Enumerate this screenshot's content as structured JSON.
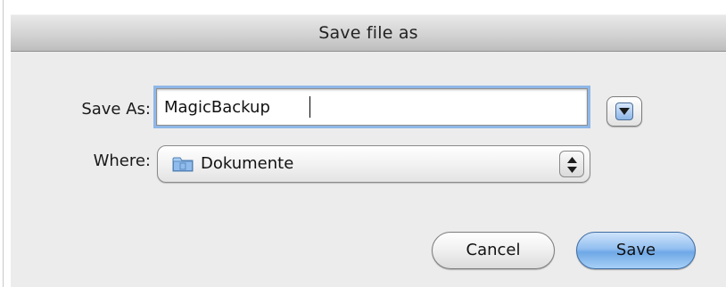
{
  "dialog": {
    "title": "Save file as"
  },
  "form": {
    "save_as_label": "Save As:",
    "save_as_value": "MagicBackup",
    "where_label": "Where:",
    "where_value": "Dokumente",
    "where_icon": "folder-icon"
  },
  "buttons": {
    "cancel_label": "Cancel",
    "save_label": "Save"
  },
  "colors": {
    "focus_ring": "#8fb7e8",
    "default_button": "#6fa8e6"
  }
}
